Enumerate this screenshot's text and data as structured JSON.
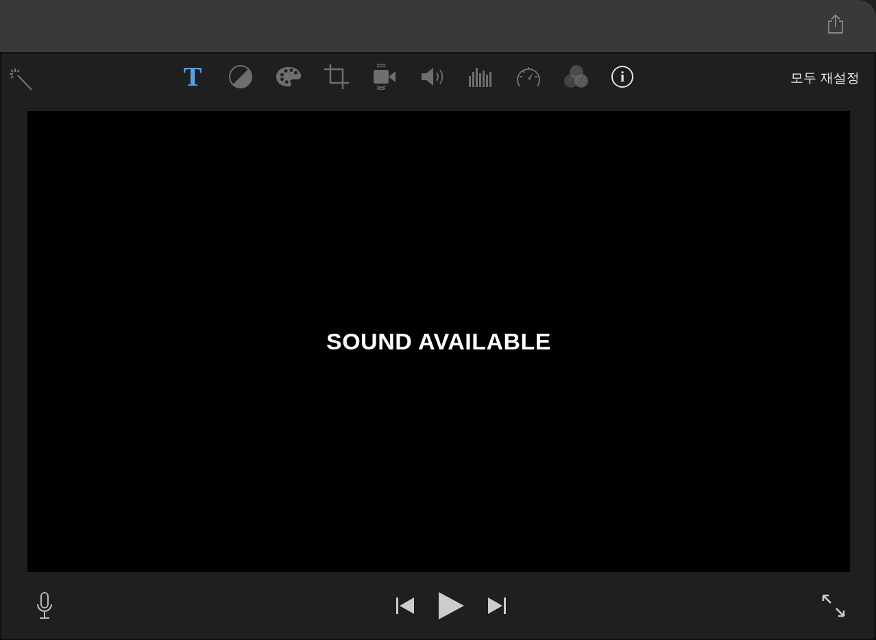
{
  "toolbar": {
    "tools": [
      {
        "kind": "title",
        "label": "T",
        "selected": true,
        "bright": false
      },
      {
        "kind": "balance",
        "selected": false,
        "bright": false
      },
      {
        "kind": "palette",
        "selected": false,
        "bright": false
      },
      {
        "kind": "crop",
        "selected": false,
        "bright": false
      },
      {
        "kind": "stabilize",
        "selected": false,
        "bright": false
      },
      {
        "kind": "volume",
        "selected": false,
        "bright": false
      },
      {
        "kind": "equalizer",
        "selected": false,
        "bright": false
      },
      {
        "kind": "speed",
        "selected": false,
        "bright": false
      },
      {
        "kind": "filter",
        "selected": false,
        "bright": false
      },
      {
        "kind": "info",
        "label": "i",
        "selected": false,
        "bright": true
      }
    ],
    "reset_all": "모두 재설정"
  },
  "viewer": {
    "caption": "SOUND AVAILABLE"
  }
}
